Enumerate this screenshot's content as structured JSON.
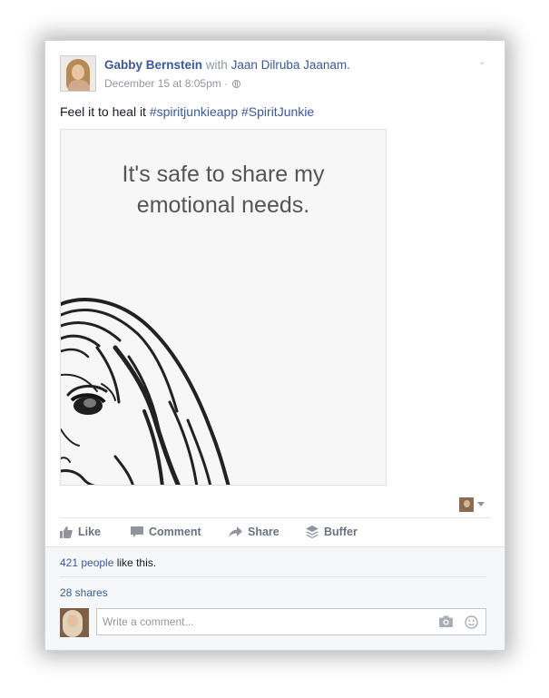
{
  "post": {
    "author": "Gabby Bernstein",
    "with_word": "with",
    "tagged": "Jaan Dilruba Jaanam.",
    "timestamp": "December 15 at 8:05pm",
    "separator": "·",
    "privacy_icon": "globe-icon",
    "caption": "Feel it to heal it",
    "hashtags": [
      "#spiritjunkieapp",
      "#SpiritJunkie"
    ],
    "image_text": "It's safe to share my\nemotional needs."
  },
  "actions": {
    "like": "Like",
    "comment": "Comment",
    "share": "Share",
    "buffer": "Buffer"
  },
  "footer": {
    "likes_count": "421 people",
    "likes_suffix": " like this.",
    "shares": "28 shares"
  },
  "comment": {
    "placeholder": "Write a comment..."
  },
  "colors": {
    "link": "#3b5998",
    "muted": "#9197a3",
    "footer_bg": "#f6f7f9"
  }
}
